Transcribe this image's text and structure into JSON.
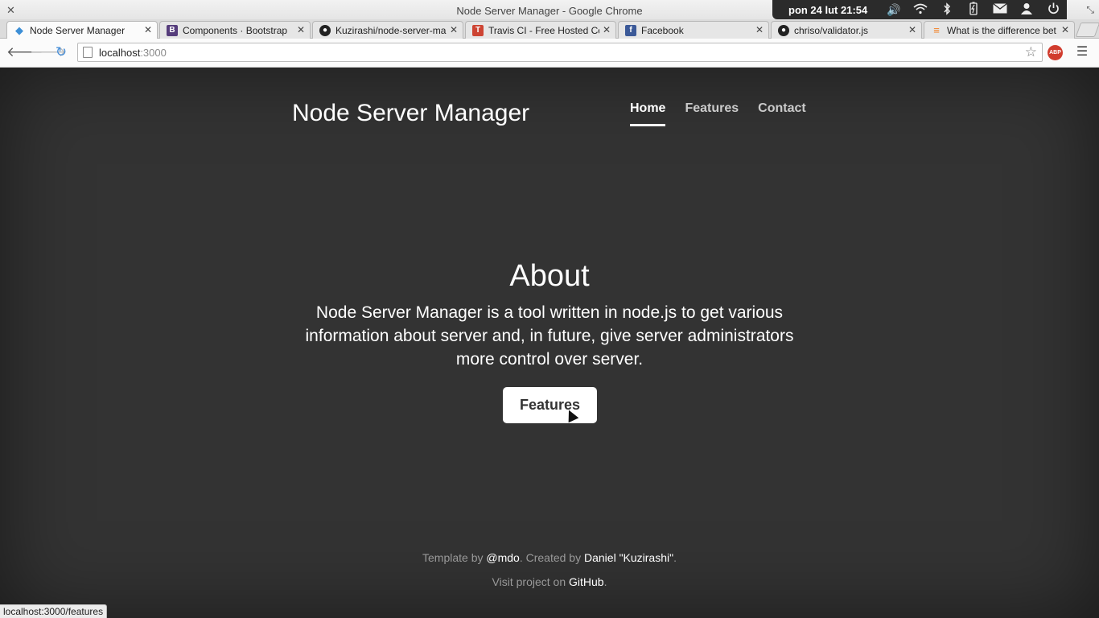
{
  "window": {
    "title": "Node Server Manager - Google Chrome",
    "close_glyph": "✕",
    "restore_glyph": "⤡"
  },
  "tray": {
    "clock": "pon 24 lut 21:54",
    "icons": [
      "volume-icon",
      "wifi-icon",
      "bluetooth-icon",
      "battery-icon",
      "mail-icon",
      "user-icon",
      "power-icon"
    ]
  },
  "tabs": [
    {
      "label": "Node Server Manager",
      "favicon": "node-favicon",
      "favicon_color": "#3d8fd6",
      "active": true
    },
    {
      "label": "Components · Bootstrap",
      "favicon": "bootstrap-favicon",
      "favicon_color": "#563d7c",
      "active": false
    },
    {
      "label": "Kuzirashi/node-server-ma",
      "favicon": "github-favicon",
      "favicon_color": "#222222",
      "active": false
    },
    {
      "label": "Travis CI - Free Hosted Co",
      "favicon": "travis-favicon",
      "favicon_color": "#cd4433",
      "active": false
    },
    {
      "label": "Facebook",
      "favicon": "facebook-favicon",
      "favicon_color": "#3b5998",
      "active": false
    },
    {
      "label": "chriso/validator.js",
      "favicon": "github-favicon",
      "favicon_color": "#222222",
      "active": false
    },
    {
      "label": "What is the difference bet",
      "favicon": "stackoverflow-favicon",
      "favicon_color": "#f48024",
      "active": false
    }
  ],
  "toolbar": {
    "url_host": "localhost",
    "url_port": ":3000",
    "abp_label": "ABP"
  },
  "site": {
    "brand": "Node Server Manager",
    "nav": [
      {
        "label": "Home",
        "active": true
      },
      {
        "label": "Features",
        "active": false
      },
      {
        "label": "Contact",
        "active": false
      }
    ],
    "about_heading": "About",
    "about_text": "Node Server Manager is a tool written in node.js to get various information about server and, in future, give server administrators more control over server.",
    "features_button": "Features",
    "footer": {
      "template_prefix": "Template by ",
      "template_link": "@mdo",
      "created_prefix": ". Created by ",
      "created_link": "Daniel \"Kuzirashi\"",
      "created_suffix": ".",
      "visit_prefix": "Visit project on ",
      "visit_link": "GitHub",
      "visit_suffix": "."
    }
  },
  "status_url": "localhost:3000/features",
  "colors": {
    "page_bg": "#333333",
    "text": "#ffffff",
    "muted": "#999999"
  }
}
